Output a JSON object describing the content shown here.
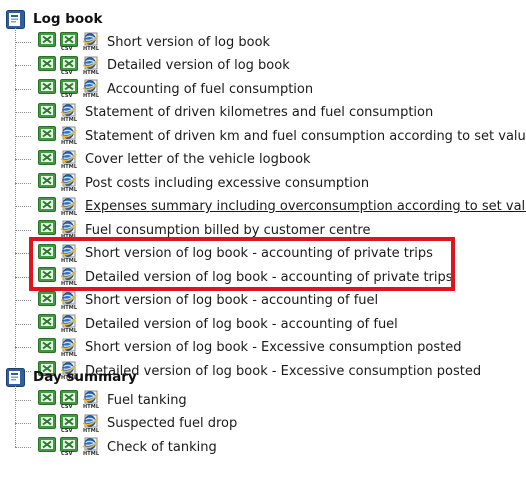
{
  "sections": [
    {
      "title": "Log book",
      "icon": "report-section-icon",
      "items": [
        {
          "label": "Short version of log book",
          "icons": [
            "xls",
            "csv",
            "html"
          ],
          "underline": false
        },
        {
          "label": "Detailed version of log book",
          "icons": [
            "xls",
            "csv",
            "html"
          ],
          "underline": false
        },
        {
          "label": "Accounting of fuel consumption",
          "icons": [
            "xls",
            "csv",
            "html"
          ],
          "underline": false
        },
        {
          "label": "Statement of driven kilometres and fuel consumption",
          "icons": [
            "xls",
            "html"
          ],
          "underline": false
        },
        {
          "label": "Statement of driven km and fuel consumption according to set values",
          "icons": [
            "xls",
            "html"
          ],
          "underline": false
        },
        {
          "label": "Cover letter of the vehicle logbook",
          "icons": [
            "xls",
            "html"
          ],
          "underline": false
        },
        {
          "label": "Post costs including excessive consumption",
          "icons": [
            "xls",
            "html"
          ],
          "underline": false
        },
        {
          "label": "Expenses summary including overconsumption according to set values",
          "icons": [
            "xls",
            "html"
          ],
          "underline": true
        },
        {
          "label": "Fuel consumption billed by customer centre",
          "icons": [
            "xls",
            "html"
          ],
          "underline": false
        },
        {
          "label": "Short version of log book - accounting of private trips",
          "icons": [
            "xls",
            "html"
          ],
          "underline": false
        },
        {
          "label": "Detailed version of log book - accounting of private trips",
          "icons": [
            "xls",
            "html"
          ],
          "underline": false
        },
        {
          "label": "Short version of log book - accounting of fuel",
          "icons": [
            "xls",
            "html"
          ],
          "underline": false
        },
        {
          "label": "Detailed version of log book - accounting of fuel",
          "icons": [
            "xls",
            "html"
          ],
          "underline": false
        },
        {
          "label": "Short version of log book - Excessive consumption posted",
          "icons": [
            "xls",
            "html"
          ],
          "underline": false
        },
        {
          "label": "Detailed version of log book - Excessive consumption posted",
          "icons": [
            "xls",
            "html"
          ],
          "underline": false
        }
      ]
    },
    {
      "title": "Day summary",
      "icon": "report-section-icon",
      "items": [
        {
          "label": "Fuel tanking",
          "icons": [
            "xls",
            "csv",
            "html"
          ],
          "underline": false
        },
        {
          "label": "Suspected fuel drop",
          "icons": [
            "xls",
            "csv",
            "html"
          ],
          "underline": false
        },
        {
          "label": "Check of tanking",
          "icons": [
            "xls",
            "csv",
            "html"
          ],
          "underline": false
        }
      ]
    }
  ],
  "icon_captions": {
    "csv": "CSV",
    "html": "HTML"
  },
  "colors": {
    "highlight": "#e0141e",
    "excel_green": "#3f9b3f",
    "section_blue": "#2f5f9e"
  }
}
